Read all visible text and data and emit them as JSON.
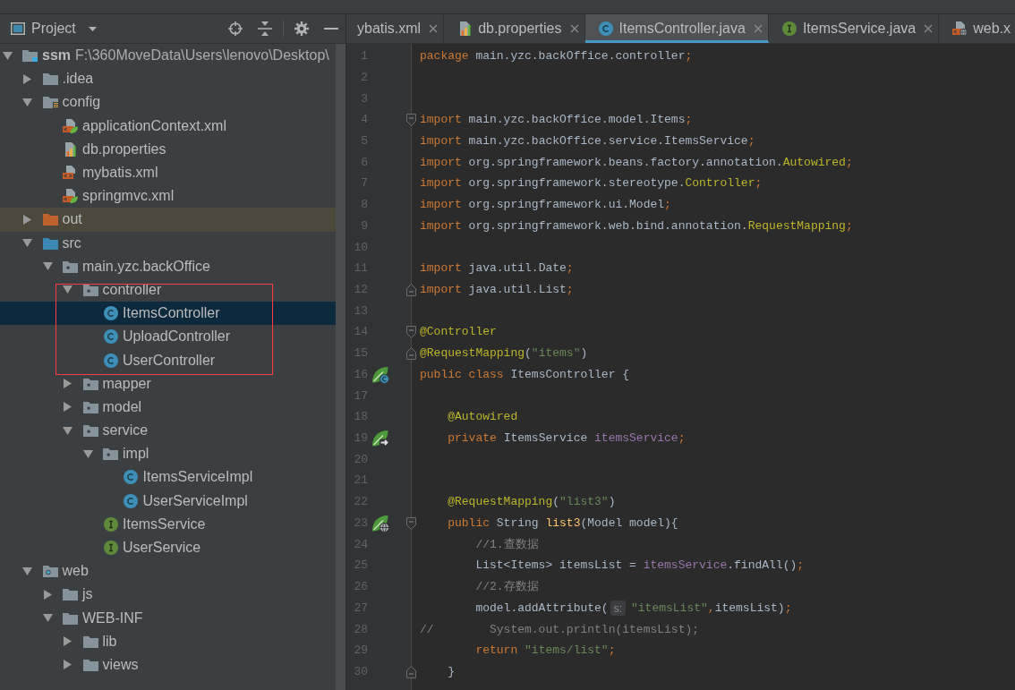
{
  "project_panel": {
    "title": "Project",
    "tree": [
      {
        "label": "ssm",
        "path": "F:\\360MoveData\\Users\\lenovo\\Desktop\\",
        "kind": "module",
        "expanded": true,
        "selected": false,
        "highlighted": false,
        "children": [
          {
            "label": ".idea",
            "kind": "folder",
            "expanded": false,
            "selected": false,
            "highlighted": false
          },
          {
            "label": "config",
            "kind": "resources",
            "expanded": true,
            "selected": false,
            "highlighted": false,
            "children": [
              {
                "label": "applicationContext.xml",
                "kind": "springxml",
                "selected": false,
                "highlighted": false
              },
              {
                "label": "db.properties",
                "kind": "properties",
                "selected": false,
                "highlighted": false
              },
              {
                "label": "mybatis.xml",
                "kind": "xml",
                "selected": false,
                "highlighted": false
              },
              {
                "label": "springmvc.xml",
                "kind": "springxml",
                "selected": false,
                "highlighted": false
              }
            ]
          },
          {
            "label": "out",
            "kind": "excluded",
            "expanded": false,
            "selected": false,
            "highlighted": false
          },
          {
            "label": "src",
            "kind": "sources",
            "expanded": true,
            "selected": false,
            "highlighted": false,
            "children": [
              {
                "label": "main.yzc.backOffice",
                "kind": "package",
                "expanded": true,
                "selected": false,
                "highlighted": false,
                "children": [
                  {
                    "label": "controller",
                    "kind": "package",
                    "expanded": true,
                    "selected": false,
                    "highlighted": true,
                    "children": [
                      {
                        "label": "ItemsController",
                        "kind": "class",
                        "selected": true,
                        "highlighted": false
                      },
                      {
                        "label": "UploadController",
                        "kind": "class",
                        "selected": false,
                        "highlighted": false
                      },
                      {
                        "label": "UserController",
                        "kind": "class",
                        "selected": false,
                        "highlighted": false
                      }
                    ]
                  },
                  {
                    "label": "mapper",
                    "kind": "package",
                    "expanded": false,
                    "selected": false,
                    "highlighted": false
                  },
                  {
                    "label": "model",
                    "kind": "package",
                    "expanded": false,
                    "selected": false,
                    "highlighted": false
                  },
                  {
                    "label": "service",
                    "kind": "package",
                    "expanded": true,
                    "selected": false,
                    "highlighted": false,
                    "children": [
                      {
                        "label": "impl",
                        "kind": "package",
                        "expanded": true,
                        "selected": false,
                        "highlighted": false,
                        "children": [
                          {
                            "label": "ItemsServiceImpl",
                            "kind": "class",
                            "selected": false,
                            "highlighted": false
                          },
                          {
                            "label": "UserServiceImpl",
                            "kind": "class",
                            "selected": false,
                            "highlighted": false
                          }
                        ]
                      },
                      {
                        "label": "ItemsService",
                        "kind": "interface",
                        "selected": false,
                        "highlighted": false
                      },
                      {
                        "label": "UserService",
                        "kind": "interface",
                        "selected": false,
                        "highlighted": false
                      }
                    ]
                  }
                ]
              }
            ]
          },
          {
            "label": "web",
            "kind": "webroot",
            "expanded": true,
            "selected": false,
            "highlighted": false,
            "children": [
              {
                "label": "js",
                "kind": "folder",
                "expanded": false,
                "selected": false,
                "highlighted": false
              },
              {
                "label": "WEB-INF",
                "kind": "folder",
                "expanded": true,
                "selected": false,
                "highlighted": false,
                "children": [
                  {
                    "label": "lib",
                    "kind": "folder",
                    "expanded": false,
                    "selected": false,
                    "highlighted": false
                  },
                  {
                    "label": "views",
                    "kind": "folder",
                    "expanded": false,
                    "selected": false,
                    "highlighted": false
                  }
                ]
              }
            ]
          }
        ]
      }
    ]
  },
  "editor": {
    "tabs": [
      {
        "label": "ybatis.xml",
        "selected": false
      },
      {
        "label": "db.properties",
        "kind": "properties",
        "selected": false
      },
      {
        "label": "ItemsController.java",
        "kind": "class",
        "selected": true
      },
      {
        "label": "ItemsService.java",
        "kind": "interface",
        "selected": false
      },
      {
        "label": "web.x",
        "kind": "webxml",
        "selected": false
      }
    ],
    "lines": [
      {
        "number": "1",
        "tokens": [
          {
            "text": "package",
            "kind": "keyword"
          },
          {
            "text": " main.yzc.backOffice.controller",
            "kind": "plain"
          },
          {
            "text": ";",
            "kind": "keyword"
          }
        ]
      },
      {
        "number": "2"
      },
      {
        "number": "3"
      },
      {
        "number": "4",
        "fold": {
          "kind": "start"
        },
        "tokens": [
          {
            "text": "import",
            "kind": "keyword"
          },
          {
            "text": " main.yzc.backOffice.model.Items",
            "kind": "plain"
          },
          {
            "text": ";",
            "kind": "keyword"
          }
        ]
      },
      {
        "number": "5",
        "tokens": [
          {
            "text": "import",
            "kind": "keyword"
          },
          {
            "text": " main.yzc.backOffice.service.ItemsService",
            "kind": "plain"
          },
          {
            "text": ";",
            "kind": "keyword"
          }
        ]
      },
      {
        "number": "6",
        "tokens": [
          {
            "text": "import",
            "kind": "keyword"
          },
          {
            "text": " org.springframework.beans.factory.annotation.",
            "kind": "plain"
          },
          {
            "text": "Autowired",
            "kind": "annotation"
          },
          {
            "text": ";",
            "kind": "keyword"
          }
        ]
      },
      {
        "number": "7",
        "tokens": [
          {
            "text": "import",
            "kind": "keyword"
          },
          {
            "text": " org.springframework.stereotype.",
            "kind": "plain"
          },
          {
            "text": "Controller",
            "kind": "annotation"
          },
          {
            "text": ";",
            "kind": "keyword"
          }
        ]
      },
      {
        "number": "8",
        "tokens": [
          {
            "text": "import",
            "kind": "keyword"
          },
          {
            "text": " org.springframework.ui.Model",
            "kind": "plain"
          },
          {
            "text": ";",
            "kind": "keyword"
          }
        ]
      },
      {
        "number": "9",
        "tokens": [
          {
            "text": "import",
            "kind": "keyword"
          },
          {
            "text": " org.springframework.web.bind.annotation.",
            "kind": "plain"
          },
          {
            "text": "RequestMapping",
            "kind": "annotation"
          },
          {
            "text": ";",
            "kind": "keyword"
          }
        ]
      },
      {
        "number": "10"
      },
      {
        "number": "11",
        "tokens": [
          {
            "text": "import",
            "kind": "keyword"
          },
          {
            "text": " java.util.Date",
            "kind": "plain"
          },
          {
            "text": ";",
            "kind": "keyword"
          }
        ]
      },
      {
        "number": "12",
        "fold": {
          "kind": "end"
        },
        "tokens": [
          {
            "text": "import",
            "kind": "keyword"
          },
          {
            "text": " java.util.List",
            "kind": "plain"
          },
          {
            "text": ";",
            "kind": "keyword"
          }
        ]
      },
      {
        "number": "13"
      },
      {
        "number": "14",
        "fold": {
          "kind": "start"
        },
        "tokens": [
          {
            "text": "@Controller",
            "kind": "annotation"
          }
        ]
      },
      {
        "number": "15",
        "fold": {
          "kind": "end"
        },
        "tokens": [
          {
            "text": "@RequestMapping",
            "kind": "annotation"
          },
          {
            "text": "(",
            "kind": "plain"
          },
          {
            "text": "\"items\"",
            "kind": "string"
          },
          {
            "text": ")",
            "kind": "plain"
          }
        ]
      },
      {
        "number": "16",
        "gutter": {
          "kind": "bean"
        },
        "tokens": [
          {
            "text": "public class",
            "kind": "keyword"
          },
          {
            "text": " ItemsController {",
            "kind": "plain"
          }
        ]
      },
      {
        "number": "17"
      },
      {
        "number": "18",
        "tokens": [
          {
            "text": "    @Autowired",
            "kind": "annotation"
          }
        ]
      },
      {
        "number": "19",
        "gutter": {
          "kind": "injection"
        },
        "tokens": [
          {
            "text": "    private",
            "kind": "keyword"
          },
          {
            "text": " ItemsService ",
            "kind": "plain"
          },
          {
            "text": "itemsService",
            "kind": "field"
          },
          {
            "text": ";",
            "kind": "keyword"
          }
        ]
      },
      {
        "number": "20"
      },
      {
        "number": "21"
      },
      {
        "number": "22",
        "tokens": [
          {
            "text": "    @RequestMapping",
            "kind": "annotation"
          },
          {
            "text": "(",
            "kind": "plain"
          },
          {
            "text": "\"list3\"",
            "kind": "string"
          },
          {
            "text": ")",
            "kind": "plain"
          }
        ]
      },
      {
        "number": "23",
        "gutter": {
          "kind": "endpoint"
        },
        "fold": {
          "kind": "start"
        },
        "tokens": [
          {
            "text": "    public",
            "kind": "keyword"
          },
          {
            "text": " String ",
            "kind": "plain"
          },
          {
            "text": "list3",
            "kind": "method"
          },
          {
            "text": "(Model model){",
            "kind": "plain"
          }
        ]
      },
      {
        "number": "24",
        "tokens": [
          {
            "text": "        //1.查数据",
            "kind": "comment"
          }
        ]
      },
      {
        "number": "25",
        "tokens": [
          {
            "text": "        List<Items> itemsList = ",
            "kind": "plain"
          },
          {
            "text": "itemsService",
            "kind": "field"
          },
          {
            "text": ".findAll()",
            "kind": "plain"
          },
          {
            "text": ";",
            "kind": "keyword"
          }
        ]
      },
      {
        "number": "26",
        "tokens": [
          {
            "text": "        //2.存数据",
            "kind": "comment"
          }
        ]
      },
      {
        "number": "27",
        "tokens": [
          {
            "text": "        model.addAttribute(",
            "kind": "plain"
          },
          {
            "text": "s:",
            "kind": "hint"
          },
          {
            "text": "\"itemsList\"",
            "kind": "string"
          },
          {
            "text": ",",
            "kind": "keyword"
          },
          {
            "text": "itemsList)",
            "kind": "plain"
          },
          {
            "text": ";",
            "kind": "keyword"
          }
        ]
      },
      {
        "number": "28",
        "tokens": [
          {
            "text": "//        System.out.println(itemsList);",
            "kind": "comment"
          }
        ]
      },
      {
        "number": "29",
        "tokens": [
          {
            "text": "        return ",
            "kind": "keyword"
          },
          {
            "text": "\"items/list\"",
            "kind": "string"
          },
          {
            "text": ";",
            "kind": "keyword"
          }
        ]
      },
      {
        "number": "30",
        "fold": {
          "kind": "end"
        },
        "tokens": [
          {
            "text": "    }",
            "kind": "plain"
          }
        ]
      }
    ]
  }
}
